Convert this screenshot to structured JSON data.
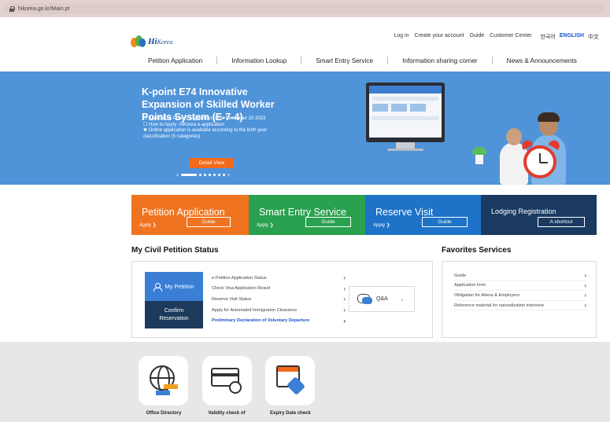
{
  "browser": {
    "url": "hikorea.go.kr/Main.pt"
  },
  "logo": {
    "hi": "Hi",
    "korea": "Korea"
  },
  "top_nav": {
    "login": "Log in",
    "create_account": "Create your account",
    "guide": "Guide",
    "customer_center": "Customer Center",
    "lang_korean": "한국어",
    "lang_english": "ENGLISH",
    "lang_chinese": "中文"
  },
  "gnb": [
    "Petition Application",
    "Information Lookup",
    "Smart Entry Service",
    "Information sharing corner",
    "News & Announcements"
  ],
  "hero": {
    "title": "K-point E74 Innovative Expansion of Skilled Worker Points System (E-7-4)",
    "line1": "☐ Application Period: September 25 to December 20 2023",
    "line2": "☐ How to Apply: HiKorea e-application",
    "line3": "✖ Online application is available according to the birth year classification (5 categories)",
    "detail_button": "Detail View",
    "prev": "‹",
    "next": "›"
  },
  "tiles": [
    {
      "title": "Petition Application",
      "apply": "Apply ❯",
      "guide": "Guide"
    },
    {
      "title": "Smart Entry Service",
      "apply": "Apply ❯",
      "guide": "Guide"
    },
    {
      "title": "Reserve Visit",
      "apply": "Apply ❯",
      "guide": "Guide"
    },
    {
      "title": "Lodging Registration",
      "guide": "A shortcut"
    }
  ],
  "petition_status": {
    "title": "My Civil Petition Status",
    "my_petition": "My Petition",
    "confirm_line1": "Confirm",
    "confirm_line2": "Reservation",
    "items": [
      "e-Petition Application Status",
      "Check Visa Application Result",
      "Reserve Visit Status",
      "Apply for Automated Immigration Clearance",
      "Preliminary Declaration of Voluntary Departure"
    ],
    "qa": "Q&A",
    "chev": "›"
  },
  "favorites": {
    "title": "Favorites Services",
    "items": [
      "Guide",
      "Application form",
      "Obligation for Aliens & Employers",
      "Reference material for naturalization interview"
    ]
  },
  "quick_icons": {
    "office": "Office Directory",
    "validity": "Validity check of",
    "expiry": "Expiry Date check"
  },
  "colors": {
    "hero_blue": "#4f93d9",
    "orange": "#f0741f",
    "green": "#2aa14f",
    "blue": "#1e73c8",
    "navy": "#1a3a62"
  }
}
